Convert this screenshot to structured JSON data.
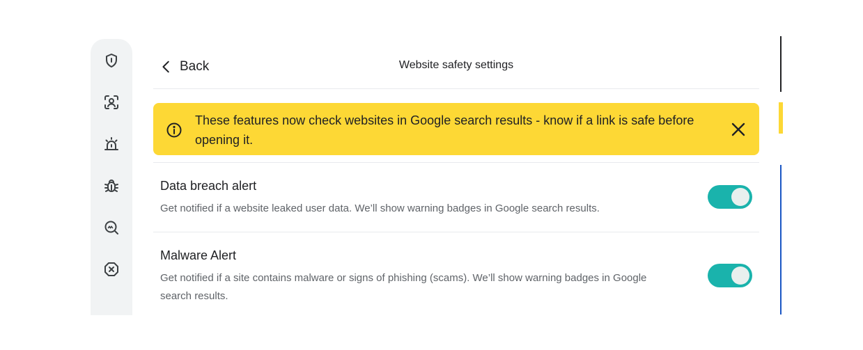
{
  "header": {
    "back_label": "Back",
    "title": "Website safety settings"
  },
  "sidebar": {
    "items": [
      {
        "icon": "shield-icon"
      },
      {
        "icon": "face-scan-icon"
      },
      {
        "icon": "alarm-icon"
      },
      {
        "icon": "bug-icon"
      },
      {
        "icon": "search-scam-icon"
      },
      {
        "icon": "blocked-icon"
      }
    ]
  },
  "banner": {
    "text": "These features now check websites in Google search results - know if a link is safe before opening it.",
    "icon": "info-icon",
    "close_icon": "close-icon",
    "color": "#fdd835"
  },
  "settings": [
    {
      "title": "Data breach alert",
      "description": "Get notified if a website leaked user data. We’ll show warning badges in Google search results.",
      "enabled": true
    },
    {
      "title": "Malware Alert",
      "description": "Get notified if a site contains malware or signs of phishing (scams). We’ll show warning badges in Google search results.",
      "enabled": true
    }
  ],
  "colors": {
    "toggle_on": "#1ab3ac",
    "sidebar_bg": "#f1f3f4"
  }
}
